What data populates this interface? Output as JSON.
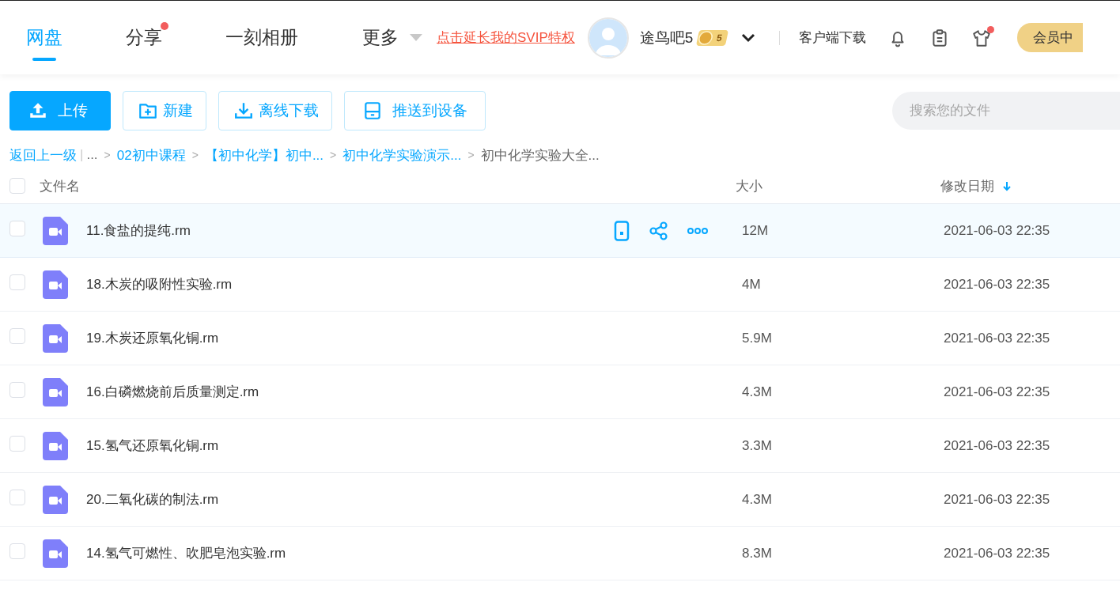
{
  "nav": {
    "tabs": [
      {
        "label": "网盘",
        "selected": true,
        "dot": false,
        "has_menu": false
      },
      {
        "label": "分享",
        "selected": false,
        "dot": true,
        "has_menu": false
      },
      {
        "label": "一刻相册",
        "selected": false,
        "dot": false,
        "has_menu": false
      },
      {
        "label": "更多",
        "selected": false,
        "dot": false,
        "has_menu": true
      }
    ],
    "promo_link": "点击延长我的SVIP特权",
    "user": {
      "name": "途鸟吧5",
      "level": "5"
    },
    "client_download": "客户端下载",
    "tools": [
      {
        "kind": "bell",
        "dot": false
      },
      {
        "kind": "clipboard",
        "dot": false
      },
      {
        "kind": "shirt",
        "dot": true
      }
    ],
    "member_button": "会员中"
  },
  "toolbar": {
    "buttons": [
      {
        "kind": "upload",
        "label": "上传",
        "primary": true
      },
      {
        "kind": "new",
        "label": "新建",
        "primary": false
      },
      {
        "kind": "download",
        "label": "离线下载",
        "primary": false
      },
      {
        "kind": "device",
        "label": "推送到设备",
        "primary": false
      }
    ],
    "search": {
      "placeholder": "搜索您的文件"
    }
  },
  "breadcrumb": {
    "back": "返回上一级",
    "divider": "|",
    "separator": ">",
    "items": [
      {
        "label": "...",
        "link": false
      },
      {
        "label": "02初中课程",
        "link": true
      },
      {
        "label": "【初中化学】初中...",
        "link": true
      },
      {
        "label": "初中化学实验演示...",
        "link": true
      },
      {
        "label": "初中化学实验大全...",
        "link": false
      }
    ]
  },
  "table": {
    "checked": false,
    "columns": [
      {
        "label": "文件名",
        "sorted": false
      },
      {
        "label": "大小",
        "sorted": false
      },
      {
        "label": "修改日期",
        "sorted": true
      }
    ],
    "rows": [
      {
        "name": "11.食盐的提纯.rm",
        "size": "12M",
        "date": "2021-06-03 22:35",
        "hovered": true,
        "checked": false
      },
      {
        "name": "18.木炭的吸附性实验.rm",
        "size": "4M",
        "date": "2021-06-03 22:35",
        "hovered": false,
        "checked": false
      },
      {
        "name": "19.木炭还原氧化铜.rm",
        "size": "5.9M",
        "date": "2021-06-03 22:35",
        "hovered": false,
        "checked": false
      },
      {
        "name": "16.白磷燃烧前后质量测定.rm",
        "size": "4.3M",
        "date": "2021-06-03 22:35",
        "hovered": false,
        "checked": false
      },
      {
        "name": "15.氢气还原氧化铜.rm",
        "size": "3.3M",
        "date": "2021-06-03 22:35",
        "hovered": false,
        "checked": false
      },
      {
        "name": "20.二氧化碳的制法.rm",
        "size": "4.3M",
        "date": "2021-06-03 22:35",
        "hovered": false,
        "checked": false
      },
      {
        "name": "14.氢气可燃性、吹肥皂泡实验.rm",
        "size": "8.3M",
        "date": "2021-06-03 22:35",
        "hovered": false,
        "checked": false
      }
    ]
  }
}
